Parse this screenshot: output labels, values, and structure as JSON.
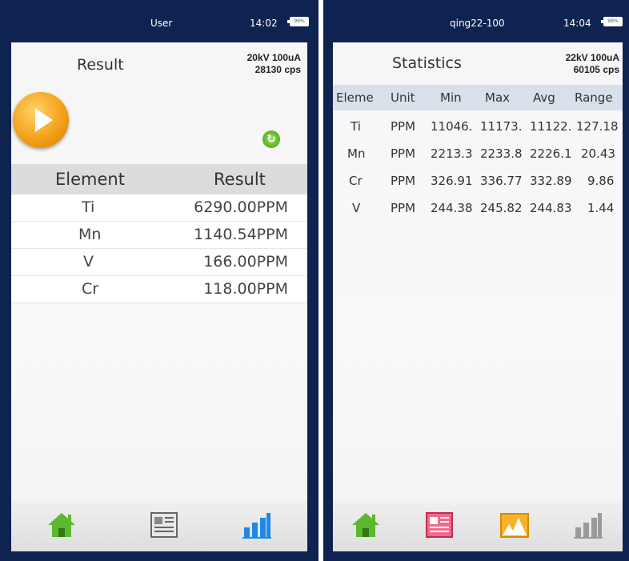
{
  "left": {
    "status": {
      "user": "User",
      "time": "14:02",
      "battery": "99%"
    },
    "header": {
      "title": "Result",
      "voltage": "20kV 100uA",
      "cps": "28130 cps"
    },
    "table": {
      "col_element": "Element",
      "col_result": "Result",
      "rows": [
        {
          "element": "Ti",
          "result": "6290.00PPM"
        },
        {
          "element": "Mn",
          "result": "1140.54PPM"
        },
        {
          "element": "V",
          "result": "166.00PPM"
        },
        {
          "element": "Cr",
          "result": "118.00PPM"
        }
      ]
    },
    "nav": [
      "home-icon",
      "report-icon",
      "chart-icon"
    ]
  },
  "right": {
    "status": {
      "user": "qing22-100",
      "time": "14:04",
      "battery": "99%"
    },
    "header": {
      "title": "Statistics",
      "voltage": "22kV 100uA",
      "cps": "60105 cps"
    },
    "table": {
      "columns": [
        "Eleme",
        "Unit",
        "Min",
        "Max",
        "Avg",
        "Range"
      ],
      "rows": [
        [
          "Ti",
          "PPM",
          "11046.",
          "11173.",
          "11122.",
          "127.18"
        ],
        [
          "Mn",
          "PPM",
          "2213.3",
          "2233.8",
          "2226.1",
          "20.43"
        ],
        [
          "Cr",
          "PPM",
          "326.91",
          "336.77",
          "332.89",
          "9.86"
        ],
        [
          "V",
          "PPM",
          "244.38",
          "245.82",
          "244.83",
          "1.44"
        ]
      ]
    },
    "nav": [
      "home-icon",
      "report-icon",
      "spectrum-icon",
      "chart-icon"
    ]
  }
}
